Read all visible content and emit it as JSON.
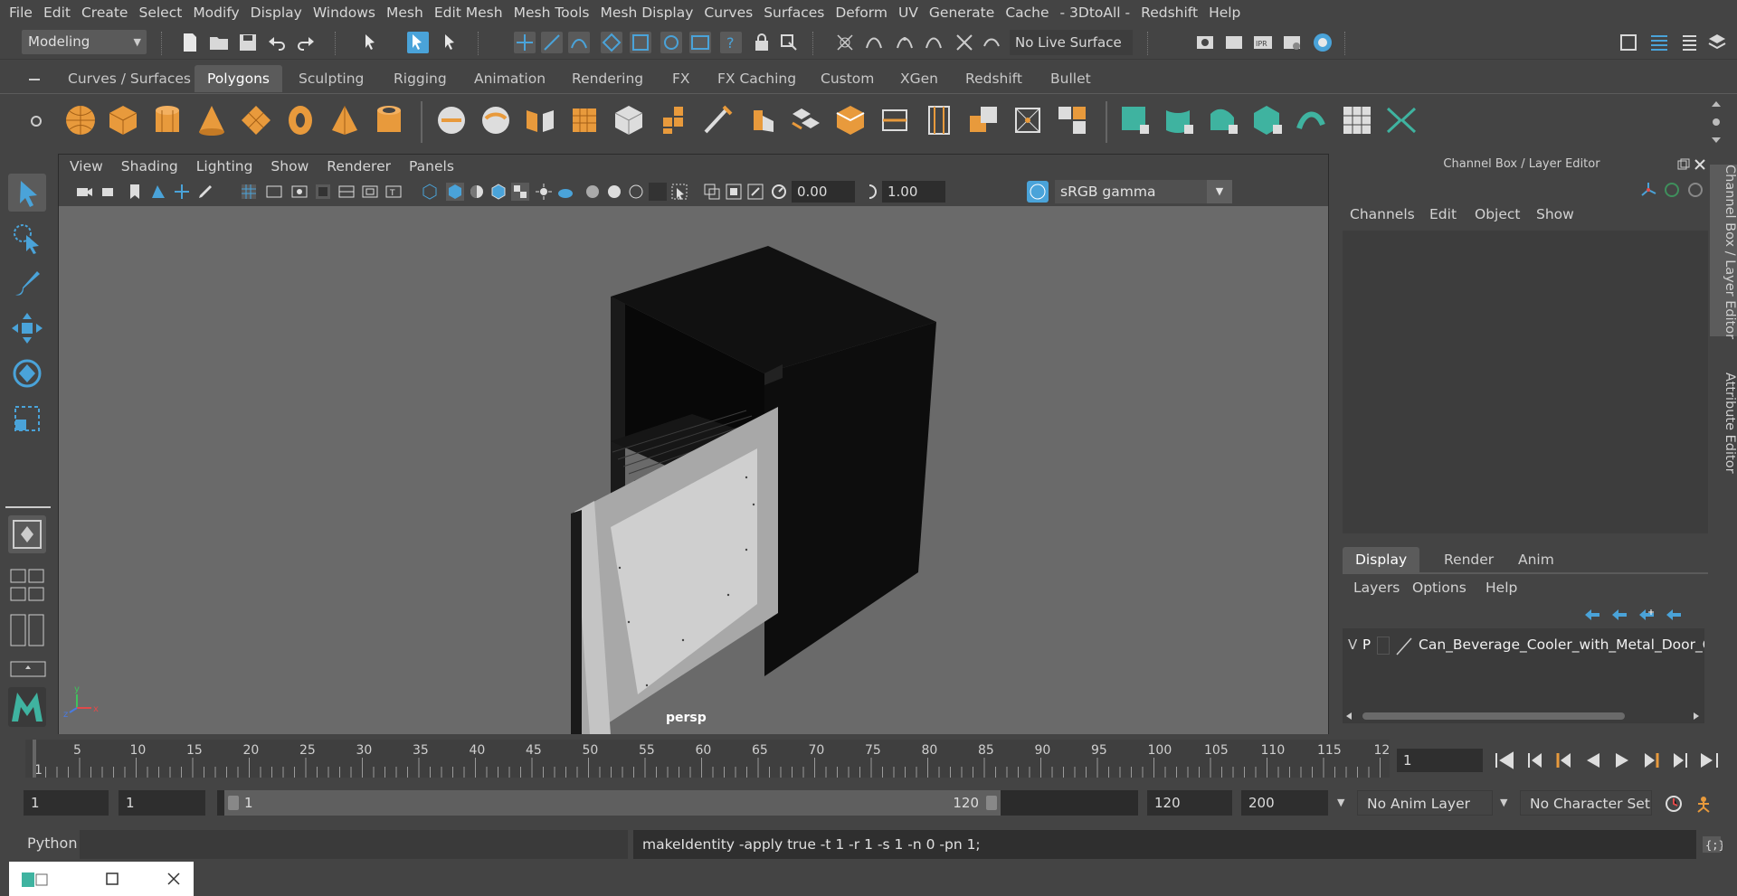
{
  "menubar": {
    "items": [
      "File",
      "Edit",
      "Create",
      "Select",
      "Modify",
      "Display",
      "Windows",
      "Mesh",
      "Edit Mesh",
      "Mesh Tools",
      "Mesh Display",
      "Curves",
      "Surfaces",
      "Deform",
      "UV",
      "Generate",
      "Cache",
      "- 3DtoAll -",
      "Redshift",
      "Help"
    ]
  },
  "statusline": {
    "mode": "Modeling",
    "live_surface": "No Live Surface"
  },
  "shelf": {
    "tabs": [
      "Curves / Surfaces",
      "Polygons",
      "Sculpting",
      "Rigging",
      "Animation",
      "Rendering",
      "FX",
      "FX Caching",
      "Custom",
      "XGen",
      "Redshift",
      "Bullet"
    ],
    "active_tab": "Polygons"
  },
  "viewport": {
    "menus": [
      "View",
      "Shading",
      "Lighting",
      "Show",
      "Renderer",
      "Panels"
    ],
    "exposure": "0.00",
    "gamma": "1.00",
    "color_management": "sRGB gamma",
    "camera_label": "persp"
  },
  "channel_box": {
    "title": "Channel Box / Layer Editor",
    "menus": [
      "Channels",
      "Edit",
      "Object",
      "Show"
    ]
  },
  "layer_editor": {
    "tabs": [
      "Display",
      "Render",
      "Anim"
    ],
    "active_tab": "Display",
    "menus": [
      "Layers",
      "Options",
      "Help"
    ],
    "layers": [
      {
        "visible": "V",
        "playback": "P",
        "name": "Can_Beverage_Cooler_with_Metal_Door_Op"
      }
    ]
  },
  "side_tabs": {
    "channel_box": "Channel Box / Layer Editor",
    "attribute_editor": "Attribute Editor"
  },
  "timeline": {
    "labels": [
      "1",
      "5",
      "10",
      "15",
      "20",
      "25",
      "30",
      "35",
      "40",
      "45",
      "50",
      "55",
      "60",
      "65",
      "70",
      "75",
      "80",
      "85",
      "90",
      "95",
      "100",
      "105",
      "110",
      "115",
      "12"
    ],
    "current_frame": "1"
  },
  "range": {
    "start": "1",
    "playback_start": "1",
    "slider_start": "1",
    "slider_end": "120",
    "playback_end": "120",
    "end": "200",
    "anim_layer": "No Anim Layer",
    "character_set": "No Character Set"
  },
  "command_line": {
    "language": "Python",
    "result": "makeIdentity -apply true -t 1 -r 1 -s 1 -n 0 -pn 1;"
  },
  "colors": {
    "accent_blue": "#4aa3d9",
    "shelf_orange": "#e89a3c",
    "shelf_green": "#3fb3a0"
  }
}
